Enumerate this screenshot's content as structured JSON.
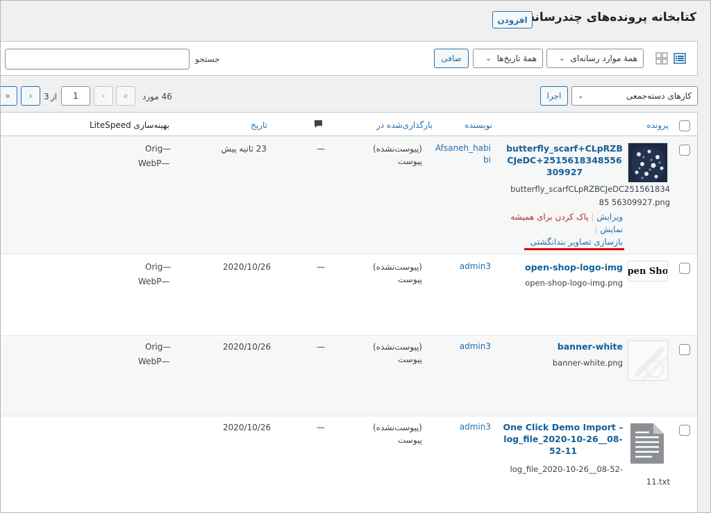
{
  "header": {
    "title": "کتابخانه پرونده‌های چندرسانه‌ای",
    "add_new": "افزودن"
  },
  "filters": {
    "media_type": "همهٔ موارد رسانه‌ای",
    "dates": "همهٔ تاریخ‌ها",
    "filter_button": "صافی",
    "search_label": "جستجو",
    "search_value": ""
  },
  "bulk": {
    "select": "کارهای دسته‌جمعی",
    "apply": "اجرا"
  },
  "pagination": {
    "count": "46 مورد",
    "current": "1",
    "of": "از",
    "total": "3",
    "first": "«",
    "prev": "‹",
    "next": "›",
    "last": "»"
  },
  "columns": {
    "file": "پرونده",
    "author": "نویسنده",
    "uploaded_to": "بارگذاری‌شده در",
    "comments_icon": "speech-bubble-icon",
    "date": "تاریخ",
    "litespeed": "بهینه‌سازی LiteSpeed"
  },
  "rows": [
    {
      "title": "butterfly_scarf+CLpRZBCJeDC+2515618348556309927",
      "filename": "butterfly_scarfCLpRZBCJeDC25156183485 56309927.png",
      "actions": {
        "edit": "ویرایش",
        "delete": "پاک کردن برای همیشه",
        "view": "نمایش",
        "regen": "بازسازی تصاویر بندانگشتی"
      },
      "author": "Afsaneh_habibi",
      "uploaded_status": "(پیوست‌نشده)",
      "attach": "پیوست",
      "comments": "—",
      "date": "23 ثانیه پیش",
      "ls_orig": "Orig—",
      "ls_webp": "WebP—"
    },
    {
      "title": "open-shop-logo-img",
      "filename": "open-shop-logo-img.png",
      "thumb_text": "pen Sho",
      "author": "admin3",
      "uploaded_status": "(پیوست‌نشده)",
      "attach": "پیوست",
      "comments": "—",
      "date": "2020/10/26",
      "ls_orig": "Orig—",
      "ls_webp": "WebP—"
    },
    {
      "title": "banner-white",
      "filename": "banner-white.png",
      "author": "admin3",
      "uploaded_status": "(پیوست‌نشده)",
      "attach": "پیوست",
      "comments": "—",
      "date": "2020/10/26",
      "ls_orig": "Orig—",
      "ls_webp": "WebP—"
    },
    {
      "title": "One Click Demo Import – log_file_2020-10-26__08-52-11",
      "filename": "log_file_2020-10-26__08-52-",
      "filename2": "11.txt",
      "author": "admin3",
      "uploaded_status": "(پیوست‌نشده)",
      "attach": "پیوست",
      "comments": "—",
      "date": "2020/10/26"
    }
  ],
  "colors": {
    "link": "#2271b1",
    "title": "#135e96",
    "danger": "#b32d2e",
    "highlight": "#e00000"
  }
}
